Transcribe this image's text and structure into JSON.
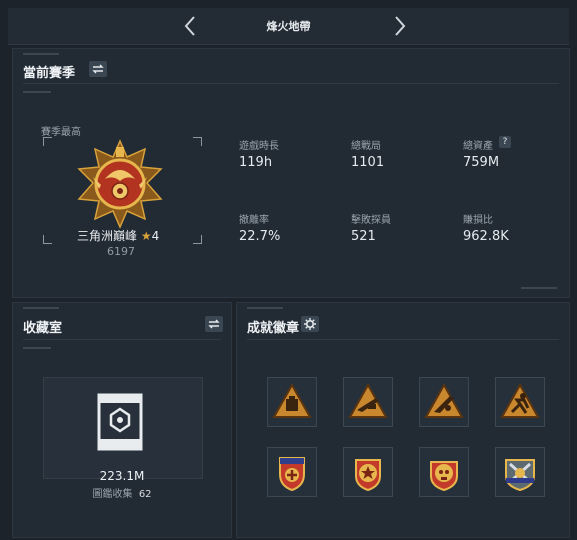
{
  "header": {
    "map_name": "烽火地帶"
  },
  "season": {
    "title": "當前賽季",
    "best_label": "賽季最高",
    "rank_name": "三角洲巔峰",
    "rank_stars": "4",
    "rank_points": "6197",
    "stats": [
      {
        "label": "遊戲時長",
        "value": "119h"
      },
      {
        "label": "總戰局",
        "value": "1101"
      },
      {
        "label": "總資產",
        "value": "759M"
      },
      {
        "label": "撤離率",
        "value": "22.7%"
      },
      {
        "label": "擊敗探員",
        "value": "521"
      },
      {
        "label": "賺損比",
        "value": "962.8K"
      }
    ],
    "help_glyph": "?"
  },
  "collection": {
    "title": "收藏室",
    "value": "223.1M",
    "catalog_label": "圖鑑收集",
    "catalog_count": "62"
  },
  "achievements": {
    "title": "成就徽章",
    "badges": [
      {
        "name": "badge-cargo",
        "color": "#c9872e"
      },
      {
        "name": "badge-rifle",
        "color": "#c9872e"
      },
      {
        "name": "badge-weapon",
        "color": "#c9872e"
      },
      {
        "name": "badge-runner",
        "color": "#c9872e"
      },
      {
        "name": "badge-shield-cross",
        "color": "#c43a2a"
      },
      {
        "name": "badge-star-emblem",
        "color": "#c43a2a"
      },
      {
        "name": "badge-skull-wreath",
        "color": "#c43a2a"
      },
      {
        "name": "badge-crossed-arms",
        "color": "#8a9aa0"
      }
    ]
  },
  "colors": {
    "gold": "#d8a23a",
    "panel": "#222a33",
    "accent": "#c9872e"
  }
}
